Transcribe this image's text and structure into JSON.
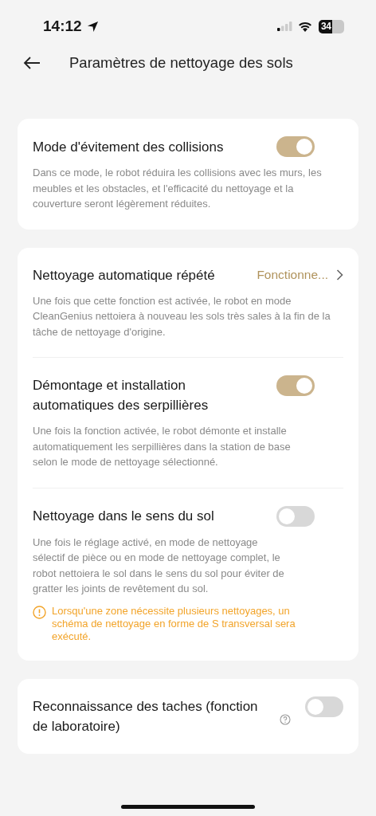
{
  "status_bar": {
    "time": "14:12",
    "battery": "34"
  },
  "header": {
    "title": "Paramètres de nettoyage des sols"
  },
  "cards": [
    {
      "items": [
        {
          "kind": "toggle",
          "title": "Mode d'évitement des collisions",
          "on": true,
          "description": "Dans ce mode, le robot réduira les collisions avec les murs, les meubles et les obstacles, et l'efficacité du nettoyage et la couverture seront légèrement réduites."
        }
      ]
    },
    {
      "items": [
        {
          "kind": "link",
          "title": "Nettoyage automatique répété",
          "value": "Fonctionne...",
          "description": "Une fois que cette fonction est activée, le robot en mode CleanGenius nettoiera à nouveau les sols très sales à la fin de la tâche de nettoyage d'origine."
        },
        {
          "kind": "toggle",
          "title": "Démontage et installation automatiques des serpillières",
          "on": true,
          "description": "Une fois la fonction activée, le robot démonte et installe automatiquement les serpillières dans la station de base selon le mode de nettoyage sélectionné."
        },
        {
          "kind": "toggle",
          "title": "Nettoyage dans le sens du sol",
          "on": false,
          "description": "Une fois le réglage activé, en mode de nettoyage sélectif de pièce ou en mode de nettoyage complet, le robot nettoiera le sol dans le sens du sol pour éviter de gratter les joints de revêtement du sol.",
          "warning": "Lorsqu'une zone nécessite plusieurs nettoyages, un schéma de nettoyage en forme de S transversal sera exécuté."
        }
      ]
    },
    {
      "items": [
        {
          "kind": "toggle",
          "title": "Reconnaissance des taches (fonction de laboratoire)",
          "on": false,
          "help": true
        }
      ]
    }
  ]
}
